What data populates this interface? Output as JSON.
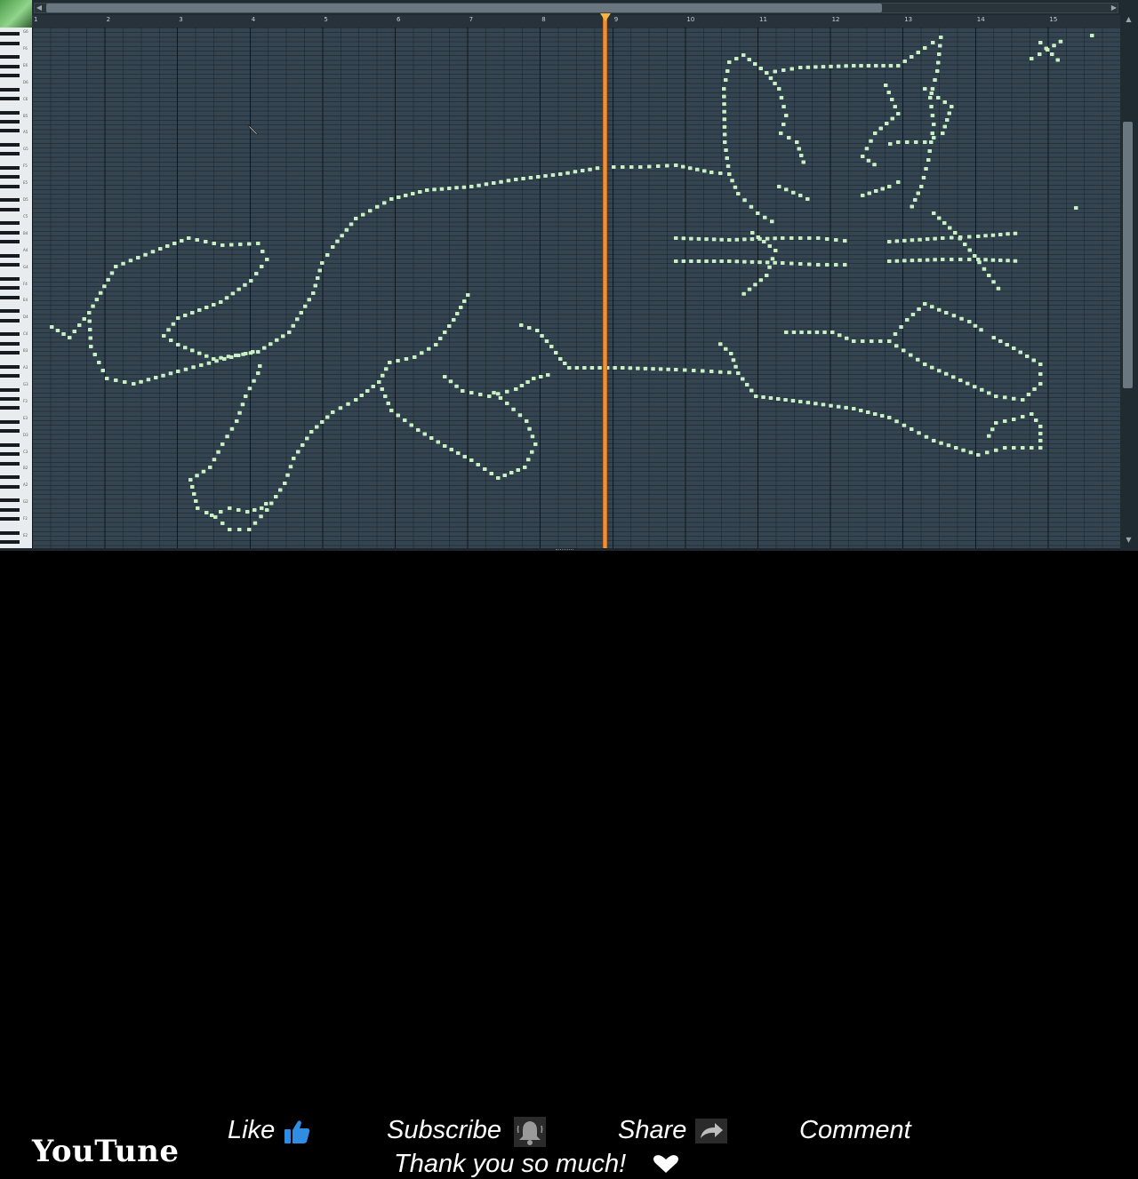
{
  "piano_roll": {
    "bar_numbers": [
      "1",
      "2",
      "3",
      "4",
      "5",
      "6",
      "7",
      "8",
      "9",
      "10",
      "11",
      "12",
      "13",
      "14",
      "15"
    ],
    "key_labels": [
      "G6",
      "F6",
      "E6",
      "D6",
      "C6",
      "B5",
      "A5",
      "G5",
      "F5",
      "E5",
      "D5",
      "C5",
      "B4",
      "A4",
      "G4",
      "F4",
      "E4",
      "D4",
      "C4",
      "B3",
      "A3",
      "G3",
      "F3",
      "E3",
      "D3",
      "C3",
      "B2",
      "A2",
      "G2",
      "F2",
      "E2"
    ],
    "playhead_bar": 9,
    "note_color": "#c8f0c4",
    "playhead_color": "#f2a04f"
  },
  "banner": {
    "brand": "YouTune",
    "like_label": "Like",
    "subscribe_label": "Subscribe",
    "share_label": "Share",
    "comment_label": "Comment",
    "thanks_label": "Thank you so much!",
    "like_icon": "thumbs-up-icon",
    "bell_icon": "bell-icon",
    "share_icon": "share-arrow-icon",
    "heart_icon": "heart-icon"
  }
}
